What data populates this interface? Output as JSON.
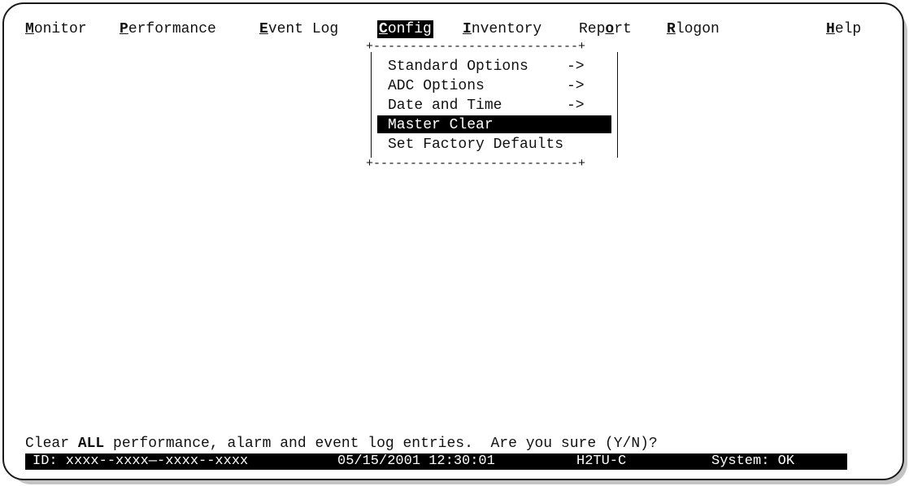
{
  "menubar": {
    "items": [
      {
        "label": "Monitor",
        "hotkey_index": 0
      },
      {
        "label": "Performance",
        "hotkey_index": 0
      },
      {
        "label": "Event Log",
        "hotkey_index": 0
      },
      {
        "label": "Config",
        "hotkey_index": 0,
        "active": true
      },
      {
        "label": "Inventory",
        "hotkey_index": 0
      },
      {
        "label": "Report",
        "hotkey_index": 3
      },
      {
        "label": "Rlogon",
        "hotkey_index": 0
      },
      {
        "label": "Help",
        "hotkey_index": 0
      }
    ]
  },
  "dropdown": {
    "items": [
      {
        "label": "Standard Options",
        "arrow": "->"
      },
      {
        "label": "ADC Options",
        "arrow": "->"
      },
      {
        "label": "Date and Time",
        "arrow": "->"
      },
      {
        "label": "Master Clear",
        "arrow": "",
        "selected": true
      },
      {
        "label": "Set Factory Defaults",
        "arrow": ""
      }
    ]
  },
  "prompt": {
    "before": "Clear ",
    "emphasis": "ALL",
    "after": " performance, alarm and event log entries.  Are you sure (Y/N)?"
  },
  "statusbar": {
    "id": "ID: xxxx--xxxx—-xxxx--xxxx",
    "datetime": "05/15/2001 12:30:01",
    "unit": "H2TU-C",
    "system": "System: OK"
  },
  "colors": {
    "background": "#ffffff",
    "text": "#111111",
    "highlight": "#000000",
    "highlight_text": "#ffffff"
  }
}
